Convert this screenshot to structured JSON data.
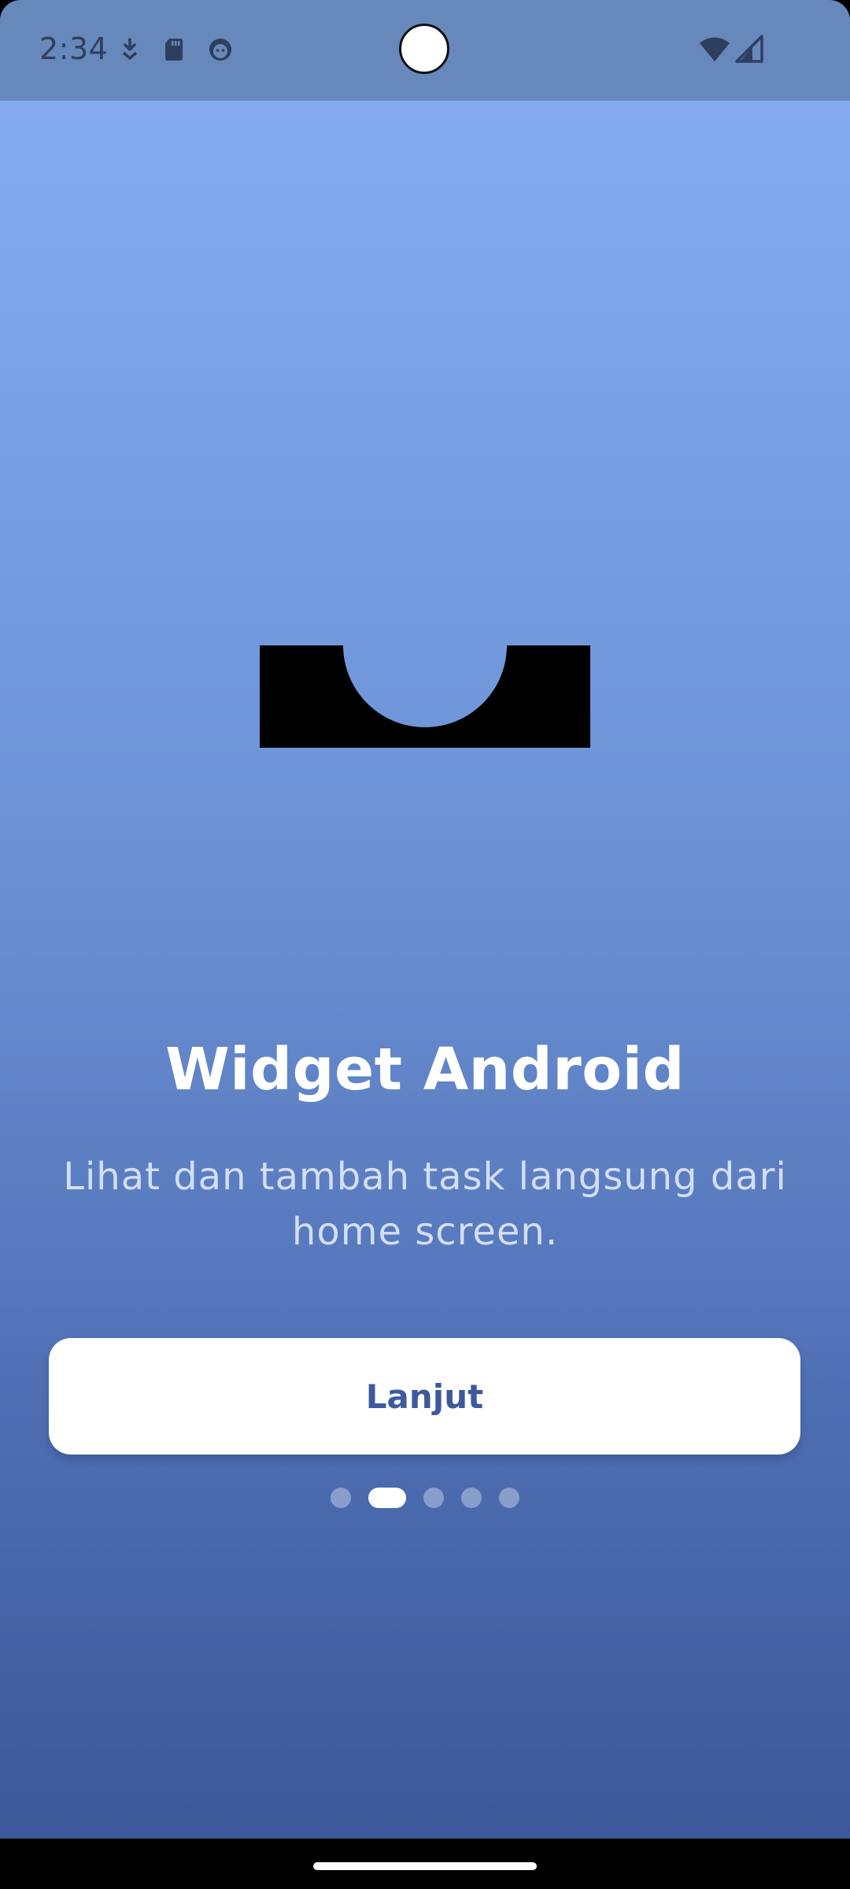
{
  "status_bar": {
    "time": "2:34",
    "left_icons": [
      "download-icon",
      "sd-card-icon",
      "face-icon"
    ],
    "right_icons": [
      "wifi-icon",
      "cellular-signal-icon"
    ]
  },
  "onboarding": {
    "title": "Widget Android",
    "subtitle": "Lihat dan tambah task langsung dari home screen.",
    "next_button_label": "Lanjut",
    "page_count": 5,
    "current_page": 2
  },
  "colors": {
    "gradient_top": "#84ABF2",
    "gradient_bottom": "#3B5899",
    "status_bar": "#6788BB",
    "button_text": "#3D5A9C",
    "subtitle": "#D4DEF2"
  }
}
